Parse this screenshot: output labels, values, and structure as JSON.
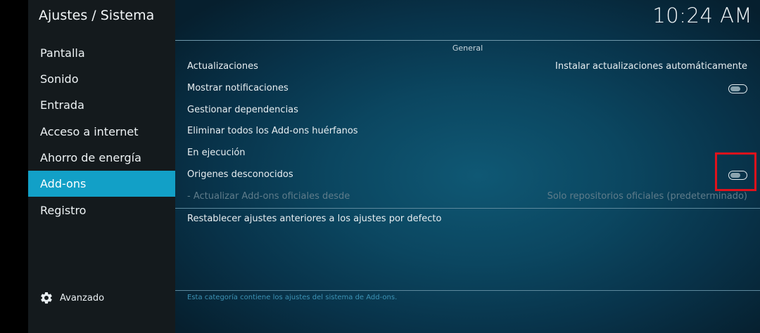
{
  "sidebar": {
    "title": "Ajustes / Sistema",
    "items": [
      {
        "label": "Pantalla"
      },
      {
        "label": "Sonido"
      },
      {
        "label": "Entrada"
      },
      {
        "label": "Acceso a internet"
      },
      {
        "label": "Ahorro de energía"
      },
      {
        "label": "Add-ons",
        "active": true
      },
      {
        "label": "Registro"
      }
    ],
    "advanced_label": "Avanzado"
  },
  "header": {
    "clock": "10:24 AM"
  },
  "main": {
    "group_title": "General",
    "settings": [
      {
        "label": "Actualizaciones",
        "value": "Instalar actualizaciones automáticamente"
      },
      {
        "label": "Mostrar notificaciones",
        "toggle": false
      },
      {
        "label": "Gestionar dependencias"
      },
      {
        "label": "Eliminar todos los Add-ons huérfanos"
      },
      {
        "label": "En ejecución"
      },
      {
        "label": "Origenes desconocidos",
        "toggle": false,
        "highlighted": true
      },
      {
        "label": "- Actualizar Add-ons oficiales desde",
        "value": "Solo repositorios oficiales (predeterminado)",
        "disabled": true
      }
    ],
    "reset_label": "Restablecer ajustes anteriores a los ajustes por defecto",
    "footer_description": "Esta categoría contiene los ajustes del sistema de Add-ons."
  },
  "colors": {
    "sidebar_bg": "#141a1d",
    "active_item": "#12a0c7",
    "highlight_box": "#e0121c",
    "footer_text": "#3d93b5"
  }
}
